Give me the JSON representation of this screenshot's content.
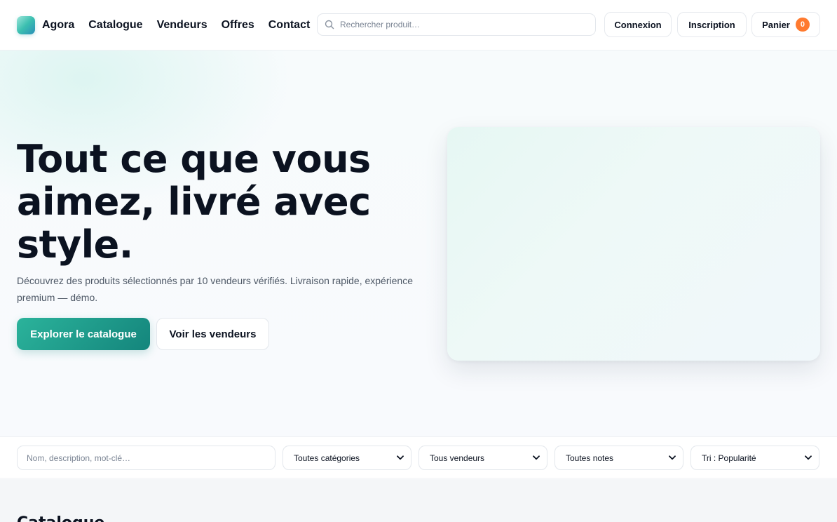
{
  "header": {
    "brand": "Agora",
    "nav": [
      "Catalogue",
      "Vendeurs",
      "Offres",
      "Contact"
    ],
    "search_placeholder": "Rechercher produit…",
    "login": "Connexion",
    "signup": "Inscription",
    "cart_label": "Panier",
    "cart_count": "0"
  },
  "hero": {
    "title": "Tout ce que vous aimez, livré avec style.",
    "subtitle": "Découvrez des produits sélectionnés par 10 vendeurs vérifiés. Livraison rapide, expérience premium — démo.",
    "primary_cta": "Explorer le catalogue",
    "secondary_cta": "Voir les vendeurs"
  },
  "filters": {
    "search_placeholder": "Nom, description, mot-clé…",
    "category": "Toutes catégories",
    "vendor": "Tous vendeurs",
    "rating": "Toutes notes",
    "sort": "Tri : Popularité"
  },
  "catalogue": {
    "title": "Catalogue"
  },
  "colors": {
    "accent": "#14857c",
    "accent_light": "#2bb39b",
    "badge": "#ff7a2f",
    "text": "#0b1220"
  },
  "icons": {
    "search": "search-icon",
    "chevron": "chevron-down-icon"
  }
}
